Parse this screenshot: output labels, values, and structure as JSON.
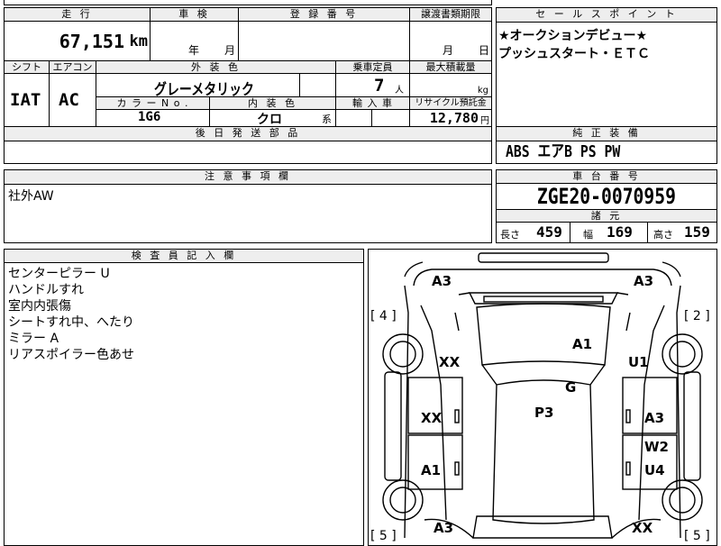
{
  "odometer": {
    "label": "走 行",
    "value": "67,151",
    "unit": "km"
  },
  "inspection": {
    "label": "車 検",
    "year_label": "年",
    "month_label": "月"
  },
  "registration": {
    "label": "登 録 番 号"
  },
  "transfer_deadline": {
    "label": "譲渡書類期限",
    "month_label": "月",
    "day_label": "日"
  },
  "shift": {
    "label": "シフト",
    "value": "IAT"
  },
  "aircon": {
    "label": "エアコン",
    "value": "AC"
  },
  "exterior_color": {
    "label": "外 装 色",
    "value": "グレーメタリック"
  },
  "color_no": {
    "label": "カ ラ ー N o .",
    "value": "1G6"
  },
  "interior_color": {
    "label": "内 装 色",
    "value": "クロ",
    "suffix": "系"
  },
  "capacity": {
    "label": "乗車定員",
    "value": "7",
    "unit": "人"
  },
  "max_load": {
    "label": "最大積載量",
    "unit": "kg"
  },
  "import": {
    "label": "輸 入 車"
  },
  "recycle": {
    "label": "リサイクル預託金",
    "value": "12,780",
    "unit": "円"
  },
  "later_parts": {
    "label": "後 日 発 送 部 品"
  },
  "sales_point": {
    "label": "セ ー ル ス ポ イ ン ト",
    "lines": [
      "★オークションデビュー★",
      "プッシュスタート・ＥＴＣ"
    ]
  },
  "equipment": {
    "label": "純 正 装 備",
    "value": "ABS エアB PS PW"
  },
  "notes": {
    "label": "注 意 事 項 欄",
    "text": "社外AW"
  },
  "chassis": {
    "label": "車 台 番 号",
    "value": "ZGE20-0070959"
  },
  "specs": {
    "label": "諸 元",
    "length_label": "長さ",
    "length": "459",
    "width_label": "幅",
    "width": "169",
    "height_label": "高さ",
    "height": "159"
  },
  "inspector": {
    "label": "検 査 員 記 入 欄",
    "lines": [
      "センターピラー U",
      "ハンドルすれ",
      "室内内張傷",
      "シートすれ中、へたり",
      "ミラー A",
      "リアスポイラー色あせ"
    ]
  },
  "diagram": {
    "top_left": "A3",
    "top_right": "A3",
    "door_front_left": "XX",
    "door_front_right": "U1",
    "roof_front": "A1",
    "roof_mid": "G",
    "roof_main": "P3",
    "door_mid_left": "XX",
    "door_mid_right": "A3",
    "door_rear_right_upper": "W2",
    "door_rear_left": "A1",
    "door_rear_right": "U4",
    "bottom_left": "A3",
    "bottom_right": "XX",
    "tire_labels": [
      "[ 4 ]",
      "[ 2 ]",
      "[ 5 ]",
      "[ 5 ]"
    ]
  }
}
